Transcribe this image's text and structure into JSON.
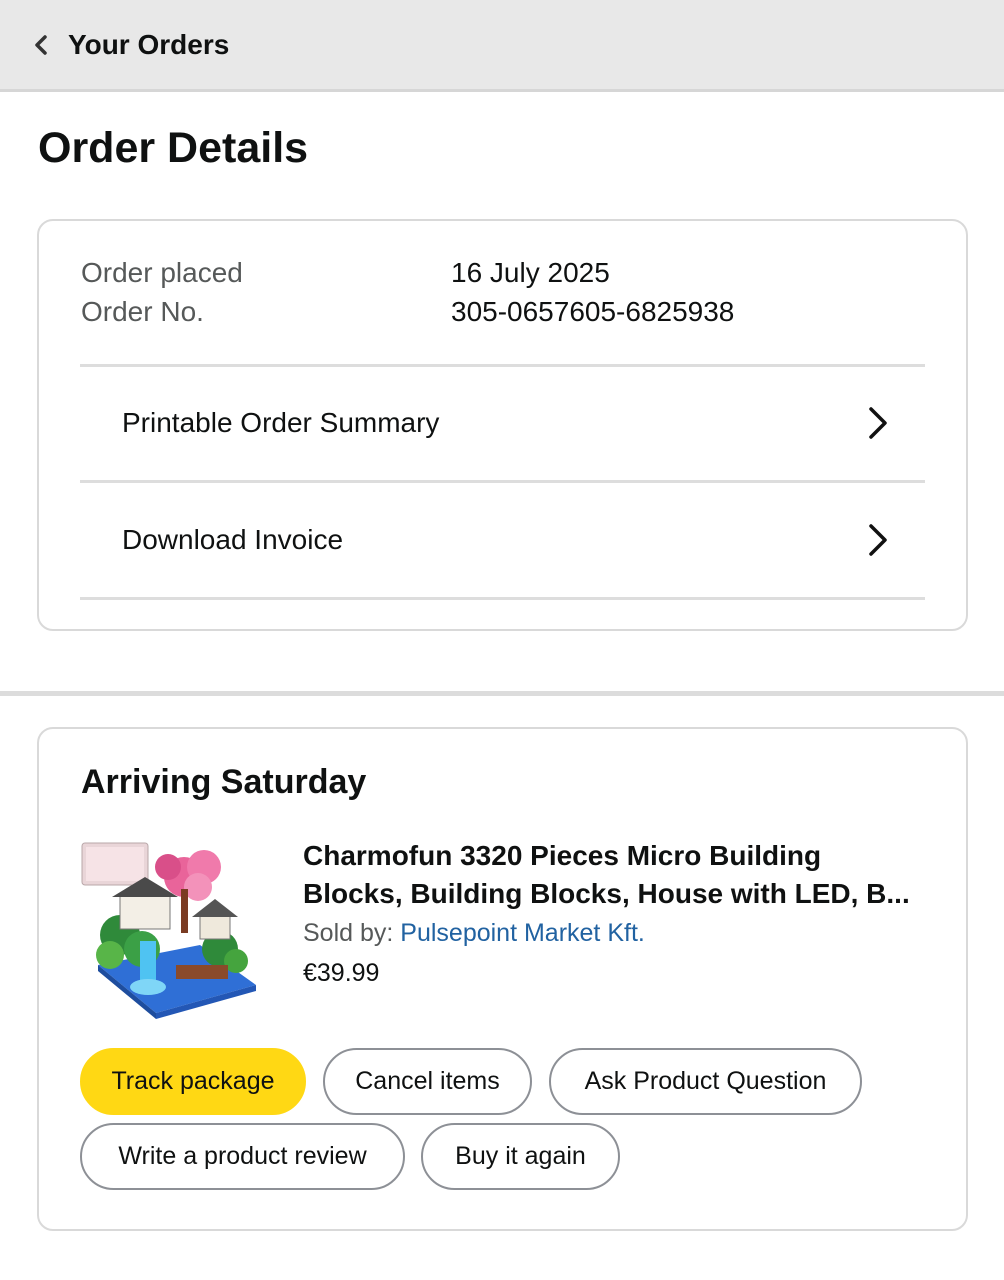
{
  "header": {
    "back_label": "Your Orders"
  },
  "page": {
    "title": "Order Details"
  },
  "order": {
    "placed_label": "Order placed",
    "placed_value": "16 July 2025",
    "number_label": "Order No.",
    "number_value": "305-0657605-6825938",
    "links": [
      {
        "label": "Printable Order Summary"
      },
      {
        "label": "Download Invoice"
      }
    ]
  },
  "shipment": {
    "status": "Arriving Saturday",
    "product": {
      "title_line1": "Charmofun 3320 Pieces Micro Building",
      "title_line2": "Blocks, Building Blocks, House with LED, B...",
      "sold_by_label": "Sold by: ",
      "seller": "Pulsepoint Market Kft.",
      "price": "€39.99",
      "image_icon": "product-thumbnail"
    },
    "actions": {
      "track": "Track package",
      "cancel": "Cancel items",
      "ask": "Ask Product Question",
      "review": "Write a product review",
      "buy_again": "Buy it again"
    }
  },
  "colors": {
    "primary_button": "#ffd814",
    "link": "#2162a1",
    "header_bg": "#e8e8e8"
  }
}
